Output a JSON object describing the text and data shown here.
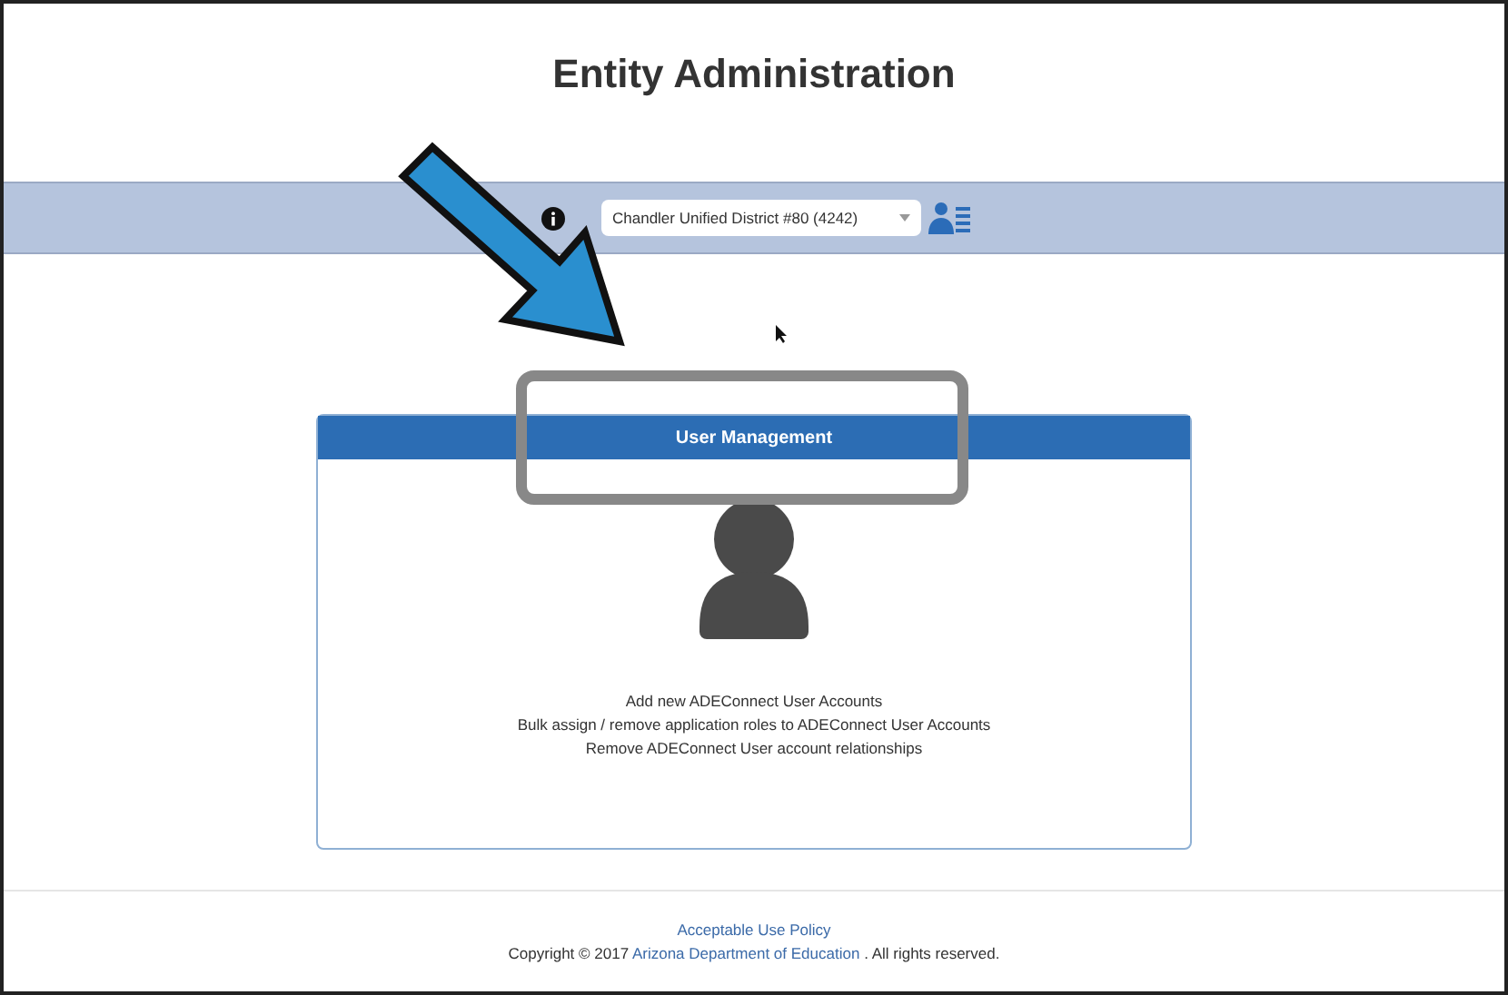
{
  "page": {
    "title": "Entity Administration"
  },
  "toolbar": {
    "entity_select": {
      "value": "Chandler Unified District #80 (4242)"
    }
  },
  "card": {
    "title": "User Management",
    "lines": [
      "Add new ADEConnect User Accounts",
      "Bulk assign / remove application roles to ADEConnect User Accounts",
      "Remove ADEConnect User account relationships"
    ]
  },
  "footer": {
    "policy_link": "Acceptable Use Policy",
    "copyright_prefix": "Copyright © 2017",
    "copyright_link": "Arizona Department of Education",
    "copyright_suffix": ". All rights reserved."
  }
}
